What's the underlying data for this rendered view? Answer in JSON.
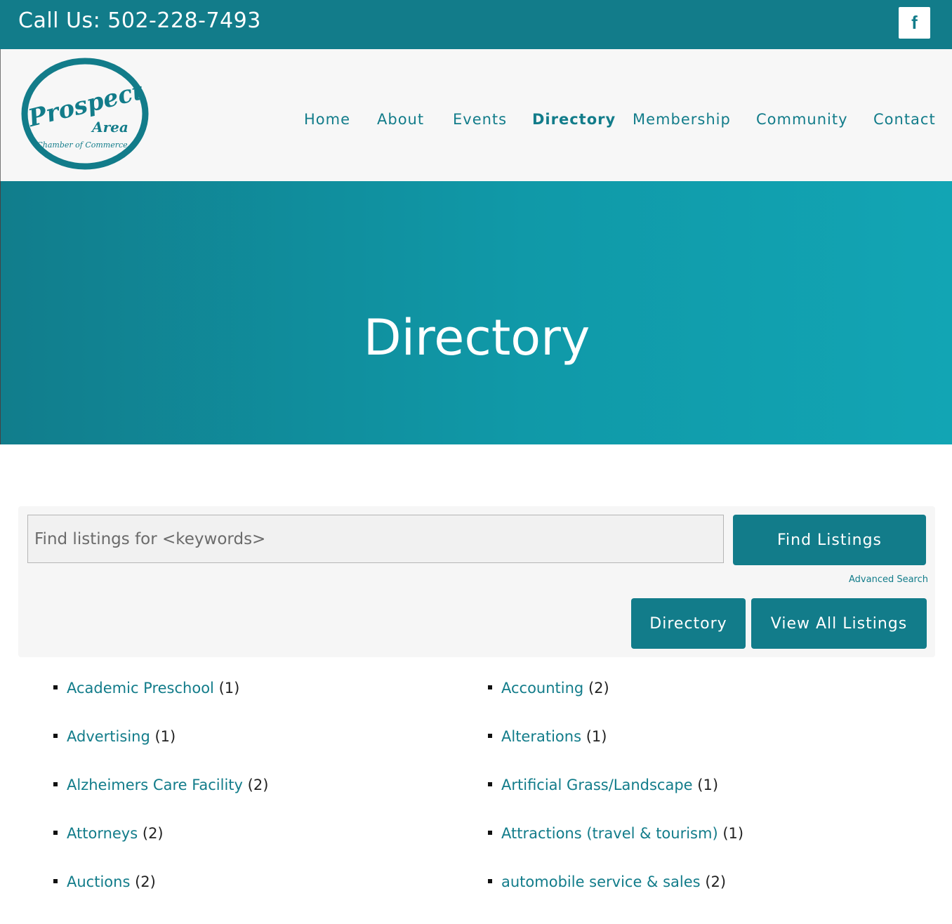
{
  "topbar": {
    "phone": "Call Us: 502-228-7493",
    "facebook_icon": "facebook-icon",
    "facebook_glyph": "f"
  },
  "logo": {
    "word": "Prospect",
    "area": "Area",
    "tagline": "Chamber of Commerce"
  },
  "nav": {
    "home": "Home",
    "about": "About",
    "events": "Events",
    "directory": "Directory",
    "membership": "Membership",
    "community": "Community",
    "contact": "Contact"
  },
  "hero": {
    "title": "Directory"
  },
  "search": {
    "placeholder": "Find listings for <keywords>",
    "find_label": "Find Listings",
    "advanced_label": "Advanced Search",
    "directory_label": "Directory",
    "view_all_label": "View All Listings"
  },
  "categories": [
    {
      "name": "Academic Preschool",
      "count": "(1)"
    },
    {
      "name": "Accounting",
      "count": "(2)"
    },
    {
      "name": "Advertising",
      "count": "(1)"
    },
    {
      "name": "Alterations",
      "count": "(1)"
    },
    {
      "name": "Alzheimers Care Facility",
      "count": "(2)"
    },
    {
      "name": "Artificial Grass/Landscape",
      "count": "(1)"
    },
    {
      "name": "Attorneys",
      "count": "(2)"
    },
    {
      "name": "Attractions (travel & tourism)",
      "count": "(1)"
    },
    {
      "name": "Auctions",
      "count": "(2)"
    },
    {
      "name": "automobile service & sales",
      "count": "(2)"
    }
  ],
  "colors": {
    "brand": "#127c8a",
    "hero_start": "#117d8c",
    "hero_end": "#12a5b4"
  }
}
